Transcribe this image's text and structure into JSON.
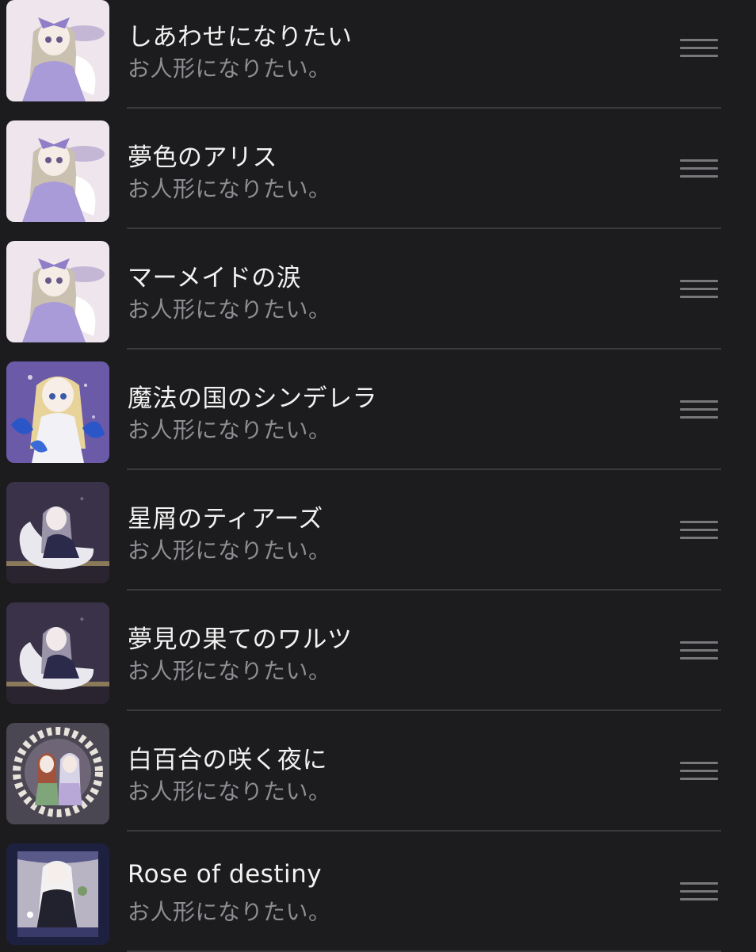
{
  "colors": {
    "background": "#1c1c1e",
    "title": "#f2f2f2",
    "subtitle": "#8e8e93",
    "separator": "#3a3a3c",
    "handle": "#78787c"
  },
  "songs": [
    {
      "title": "しあわせになりたい",
      "artist": "お人形になりたい。",
      "artwork": "lavender-bow-doll-artwork"
    },
    {
      "title": "夢色のアリス",
      "artist": "お人形になりたい。",
      "artwork": "lavender-bow-doll-artwork"
    },
    {
      "title": "マーメイドの涙",
      "artist": "お人形になりたい。",
      "artwork": "lavender-bow-doll-artwork"
    },
    {
      "title": "魔法の国のシンデレラ",
      "artist": "お人形になりたい。",
      "artwork": "blonde-doll-blue-butterflies-artwork"
    },
    {
      "title": "星屑のティアーズ",
      "artist": "お人形になりたい。",
      "artwork": "doll-on-swan-artwork"
    },
    {
      "title": "夢見の果てのワルツ",
      "artist": "お人形になりたい。",
      "artwork": "doll-on-swan-artwork"
    },
    {
      "title": "白百合の咲く夜に",
      "artist": "お人形になりたい。",
      "artwork": "two-dolls-flower-wreath-artwork"
    },
    {
      "title": "Rose of destiny",
      "artist": "お人形になりたい。",
      "artwork": "white-haired-doll-frame-artwork"
    }
  ],
  "row_control_icon": "reorder-handle-icon"
}
